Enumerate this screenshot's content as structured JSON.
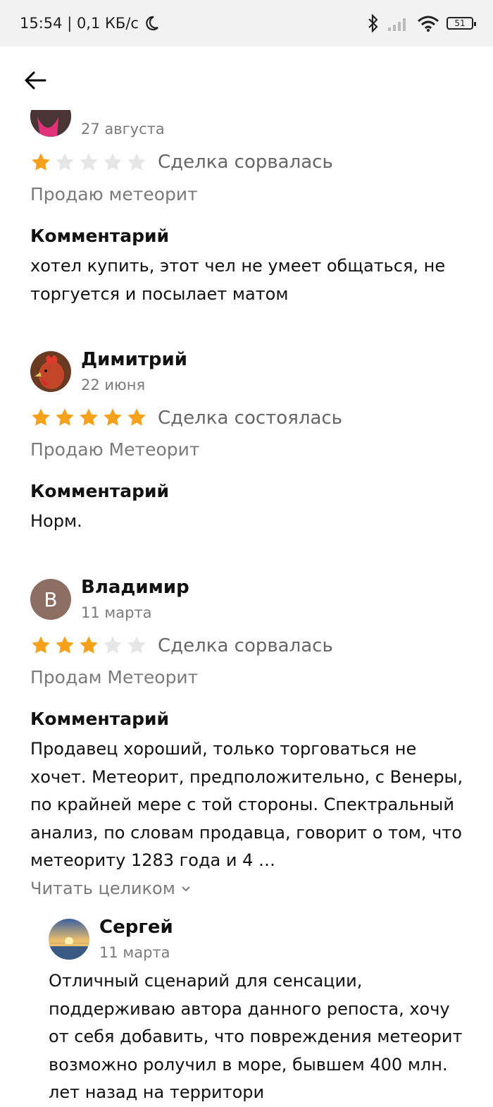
{
  "status_bar": {
    "time_net": "15:54 | 0,1 КБ/с",
    "battery": "51"
  },
  "reviews": [
    {
      "date": "27 августа",
      "rating": 1,
      "deal_status": "Сделка сорвалась",
      "product": "Продаю метеорит",
      "comment_title": "Комментарий",
      "comment": "хотел купить, этот чел не умеет общаться, не торгуется и посылает матом"
    },
    {
      "name": "Димитрий",
      "date": "22 июня",
      "rating": 5,
      "deal_status": "Сделка состоялась",
      "product": "Продаю Метеорит",
      "comment_title": "Комментарий",
      "comment": "Норм."
    },
    {
      "name": "Владимир",
      "avatar_letter": "В",
      "date": "11 марта",
      "rating": 3,
      "deal_status": "Сделка сорвалась",
      "product": "Продам Метеорит",
      "comment_title": "Комментарий",
      "comment": "Продавец хороший, только торговаться не хочет. Метеорит, предположительно, с Венеры, по крайней мере с той стороны. Спектральный анализ, по словам продавца, говорит о том, что метеориту 1283 года и 4 …",
      "read_more": "Читать целиком"
    }
  ],
  "reply": {
    "name": "Сергей",
    "date": "11 марта",
    "text": "Отличный сценарий для сенсации, поддерживаю автора данного репоста, хочу от себя добавить, что повреждения метеорит возможно ролучил в море, бывшем 400 млн. лет назад на территори"
  },
  "colors": {
    "star_filled": "#f5a11c",
    "star_empty": "#e6e6e6",
    "avatar_vladimir": "#8d6e63"
  }
}
